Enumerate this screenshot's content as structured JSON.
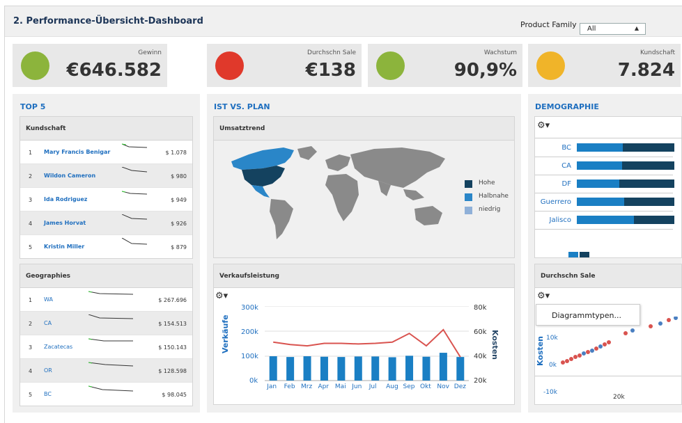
{
  "header": {
    "title": "2. Performance-Übersicht-Dashboard",
    "filter_label": "Product Family",
    "filter_value": "All"
  },
  "kpis": [
    {
      "label": "Gewinn",
      "value": "€646.582",
      "status_color": "#8cb43c"
    },
    {
      "label": "Durchschn Sale",
      "value": "€138",
      "status_color": "#e0392b"
    },
    {
      "label": "Wachstum",
      "value": "90,9%",
      "status_color": "#8cb43c"
    },
    {
      "label": "Kundschaft",
      "value": "7.824",
      "status_color": "#f0b429"
    }
  ],
  "top5": {
    "title": "TOP 5",
    "customers_header": "Kundschaft",
    "customers": [
      {
        "rank": "1",
        "name": "Mary Francis Benigar",
        "value": "$ 1.078"
      },
      {
        "rank": "2",
        "name": "Wildon Cameron",
        "value": "$ 980"
      },
      {
        "rank": "3",
        "name": "Ida Rodriguez",
        "value": "$ 949"
      },
      {
        "rank": "4",
        "name": "James Horvat",
        "value": "$ 926"
      },
      {
        "rank": "5",
        "name": "Kristin Miller",
        "value": "$ 879"
      }
    ],
    "geo_header": "Geographies",
    "geographies": [
      {
        "rank": "1",
        "name": "WA",
        "value": "$ 267.696"
      },
      {
        "rank": "2",
        "name": "CA",
        "value": "$ 154.513"
      },
      {
        "rank": "3",
        "name": "Zacatecas",
        "value": "$ 150.143"
      },
      {
        "rank": "4",
        "name": "OR",
        "value": "$ 128.598"
      },
      {
        "rank": "5",
        "name": "BC",
        "value": "$ 98.045"
      }
    ]
  },
  "plan": {
    "title": "IST VS. PLAN",
    "map_header": "Umsatztrend",
    "legend": [
      {
        "label": "Hohe",
        "color": "#14425f"
      },
      {
        "label": "Halbnahe",
        "color": "#2a86c8"
      },
      {
        "label": "niedrig",
        "color": "#8fb0d8"
      }
    ],
    "sales_header": "Verkaufsleistung"
  },
  "demographie": {
    "title": "DEMOGRAPHIE",
    "rows": [
      "BC",
      "CA",
      "DF",
      "Guerrero",
      "Jalisco"
    ],
    "avg_header": "Durchschn Sale",
    "menu_item": "Diagrammtypen...",
    "scatter_ylabel": "Kosten",
    "scatter_yticks": [
      "10k",
      "0k",
      "-10k"
    ],
    "scatter_xtick": "20k"
  },
  "chart_data": {
    "type": "bar",
    "title": "",
    "categories": [
      "Jan",
      "Feb",
      "Mrz",
      "Apr",
      "Mai",
      "Jun",
      "Jul",
      "Aug",
      "Sep",
      "Okt",
      "Nov",
      "Dez"
    ],
    "ylabel": "Verkäufe",
    "y2label": "Kosten",
    "ylim": [
      0,
      300000
    ],
    "y2lim": [
      20000,
      80000
    ],
    "yticks": [
      "300k",
      "200k",
      "100k",
      "0k"
    ],
    "y2ticks": [
      "80k",
      "60k",
      "40k",
      "20k"
    ],
    "series": [
      {
        "name": "Verkäufe",
        "type": "bar",
        "color": "#1a7fc4",
        "values": [
          98000,
          95000,
          98000,
          96000,
          95000,
          97000,
          97000,
          94000,
          100000,
          96000,
          112000,
          95000
        ]
      },
      {
        "name": "Kosten",
        "type": "line",
        "axis": "right",
        "color": "#d9534f",
        "values": [
          51000,
          49000,
          48000,
          50000,
          50000,
          49500,
          50000,
          51000,
          58000,
          48000,
          61000,
          39000
        ]
      }
    ]
  }
}
